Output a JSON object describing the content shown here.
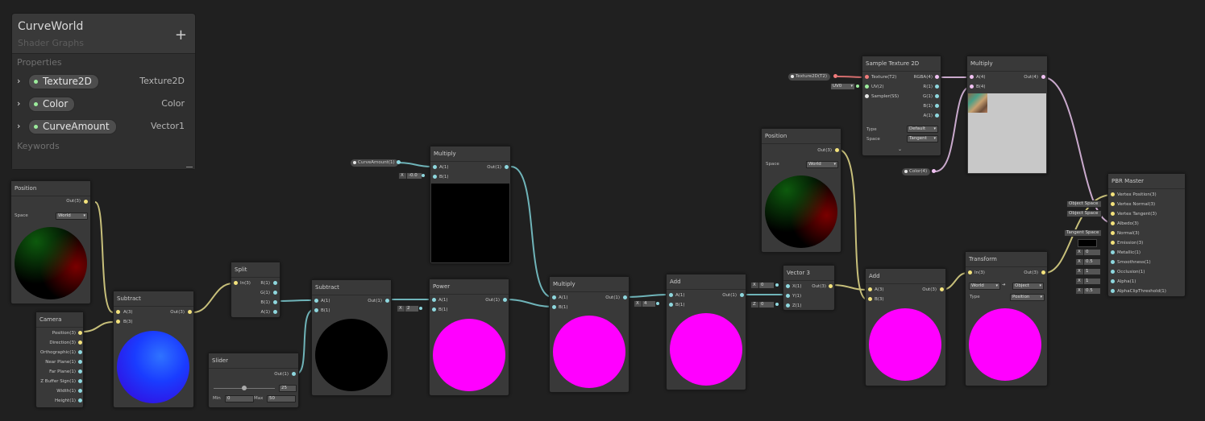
{
  "blackboard": {
    "title": "CurveWorld",
    "subtitle": "Shader Graphs",
    "add_label": "+",
    "properties_label": "Properties",
    "keywords_label": "Keywords",
    "properties": [
      {
        "name": "Texture2D",
        "type": "Texture2D"
      },
      {
        "name": "Color",
        "type": "Color"
      },
      {
        "name": "CurveAmount",
        "type": "Vector1"
      }
    ]
  },
  "colors": {
    "background": "#202020",
    "node": "#393939",
    "wire_vector": "#8ed7de",
    "wire_vec3": "#f3e27c",
    "wire_vec4": "#f0c1f2",
    "magenta": "#ff00ff"
  },
  "nodes": {
    "position1": {
      "title": "Position",
      "out": "Out(3)",
      "space_label": "Space",
      "space_value": "World"
    },
    "camera": {
      "title": "Camera",
      "outs": [
        "Position(3)",
        "Direction(3)",
        "Orthographic(1)",
        "Near Plane(1)",
        "Far Plane(1)",
        "Z Buffer Sign(1)",
        "Width(1)",
        "Height(1)"
      ]
    },
    "subtract1": {
      "title": "Subtract",
      "in_a": "A(3)",
      "in_b": "B(3)",
      "out": "Out(3)"
    },
    "split": {
      "title": "Split",
      "in": "In(3)",
      "outs": [
        "R(1)",
        "G(1)",
        "B(1)",
        "A(1)"
      ]
    },
    "slider": {
      "title": "Slider",
      "out": "Out(1)",
      "value": "25",
      "min_label": "Min",
      "min": "0",
      "max_label": "Max",
      "max": "50"
    },
    "subtract2": {
      "title": "Subtract",
      "in_a": "A(1)",
      "in_b": "B(1)",
      "out": "Out(1)"
    },
    "curve_prop": {
      "label": "CurveAmount(1)"
    },
    "multiply1": {
      "title": "Multiply",
      "in_a": "A(1)",
      "in_b": "B(1)",
      "out": "Out(1)",
      "b_x": "X",
      "b_val": "-0.0"
    },
    "power": {
      "title": "Power",
      "in_a": "A(1)",
      "in_b": "B(1)",
      "out": "Out(1)",
      "b_x": "X",
      "b_val": "2"
    },
    "multiply2": {
      "title": "Multiply",
      "in_a": "A(1)",
      "in_b": "B(1)",
      "out": "Out(1)"
    },
    "add1": {
      "title": "Add",
      "in_a": "A(1)",
      "in_b": "B(1)",
      "out": "Out(1)",
      "b_x": "X",
      "b_val": "4"
    },
    "vector3": {
      "title": "Vector 3",
      "ins": [
        "X(1)",
        "Y(1)",
        "Z(1)"
      ],
      "out": "Out(3)",
      "x_label": "X",
      "x_val": "0",
      "z_label": "Z",
      "z_val": "0"
    },
    "position2": {
      "title": "Position",
      "out": "Out(3)",
      "space_label": "Space",
      "space_value": "World"
    },
    "tex_prop": {
      "label": "Texture2D(T2)"
    },
    "uv_field": {
      "label": "UV0"
    },
    "sample": {
      "title": "Sample Texture 2D",
      "ins": [
        "Texture(T2)",
        "UV(2)",
        "Sampler(SS)"
      ],
      "outs": [
        "RGBA(4)",
        "R(1)",
        "G(1)",
        "B(1)",
        "A(1)"
      ],
      "type_label": "Type",
      "type_value": "Default",
      "space_label": "Space",
      "space_value": "Tangent"
    },
    "multiply3": {
      "title": "Multiply",
      "in_a": "A(4)",
      "in_b": "B(4)",
      "out": "Out(4)"
    },
    "color_prop": {
      "label": "Color(4)"
    },
    "add2": {
      "title": "Add",
      "in_a": "A(3)",
      "in_b": "B(3)",
      "out": "Out(3)"
    },
    "transform": {
      "title": "Transform",
      "in": "In(3)",
      "out": "Out(3)",
      "from": "World",
      "arrow": "➔",
      "to": "Object",
      "type_label": "Type",
      "type_value": "Position"
    },
    "master": {
      "title": "PBR Master",
      "inputs": [
        "Vertex Position(3)",
        "Vertex Normal(3)",
        "Vertex Tangent(3)",
        "Albedo(3)",
        "Normal(3)",
        "Emission(3)",
        "Metallic(1)",
        "Smoothness(1)",
        "Occlusion(1)",
        "Alpha(1)",
        "AlphaClipThreshold(1)"
      ],
      "fields": {
        "obj1": "Object Space",
        "obj2": "Object Space",
        "tangent": "Tangent Space",
        "metallic": "0",
        "smoothness": "0.5",
        "occlusion": "1",
        "alpha": "1",
        "clip": "0.5",
        "x": "X"
      }
    }
  }
}
